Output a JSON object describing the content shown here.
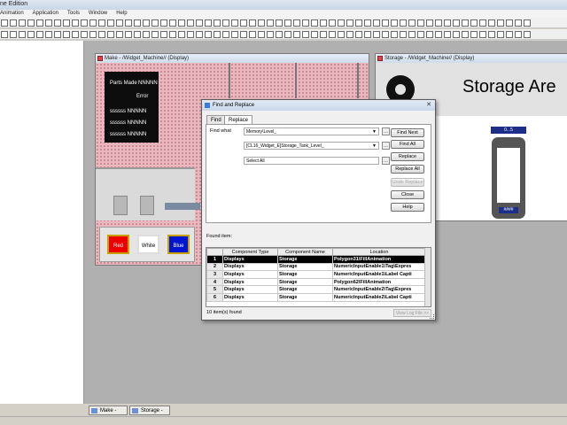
{
  "app": {
    "title": "ne Edition",
    "menu": [
      "Animation",
      "Application",
      "Tools",
      "Window",
      "Help"
    ]
  },
  "make_window": {
    "title": "Make - /Widget_Machine// (Display)",
    "parts_made_label": "Parts Made",
    "parts_made_value": "NNNNN",
    "error_label": "Error",
    "rows": [
      "ssssss  NNNNN",
      "ssssss  NNNNN",
      "ssssss  NNNNN"
    ],
    "buttons": {
      "red": "Red",
      "white": "White",
      "blue": "Blue"
    }
  },
  "storage_window": {
    "title": "Storage - /Widget_Machine// (Display)",
    "heading": "Storage Are",
    "tank_label": "0...5",
    "tank_value": "####"
  },
  "dialog": {
    "title": "Find and Replace",
    "tabs": {
      "find": "Find",
      "replace": "Replace"
    },
    "find_what_label": "Find what",
    "find_what_value": "Memory\\Level_",
    "replace_with_value": "[CL16_Widget_E]Storage_Tank_Level_",
    "scope_value": "Select All",
    "buttons": {
      "find_next": "Find Next",
      "find_all": "Find All",
      "replace": "Replace",
      "replace_all": "Replace All",
      "undo_replace": "Undo Replace",
      "close": "Close",
      "help": "Help"
    },
    "found_label": "Found item:",
    "columns": [
      "",
      "Component Type",
      "Component  Name",
      "Location"
    ],
    "rows": [
      [
        "1",
        "Displays",
        "Storage",
        "Polygon31\\FillAnimation"
      ],
      [
        "2",
        "Displays",
        "Storage",
        "NumericInputEnable1\\Tag\\Expres"
      ],
      [
        "3",
        "Displays",
        "Storage",
        "NumericInputEnable1\\Label Capti"
      ],
      [
        "4",
        "Displays",
        "Storage",
        "Polygon62\\FillAnimation"
      ],
      [
        "5",
        "Displays",
        "Storage",
        "NumericInputEnable2\\Tag\\Expres"
      ],
      [
        "6",
        "Displays",
        "Storage",
        "NumericInputEnable2\\Label Capti"
      ]
    ],
    "found_count": "10 item(s) found",
    "view_log": "View Log File >>"
  },
  "doc_tabs": {
    "make": "Make - /W...",
    "storage": "Storage - /W..."
  },
  "colors": {
    "dialog_bg": "#f0f0f0",
    "panel_bg": "#e9b7bd",
    "tank_blue": "#1d2e8a"
  }
}
